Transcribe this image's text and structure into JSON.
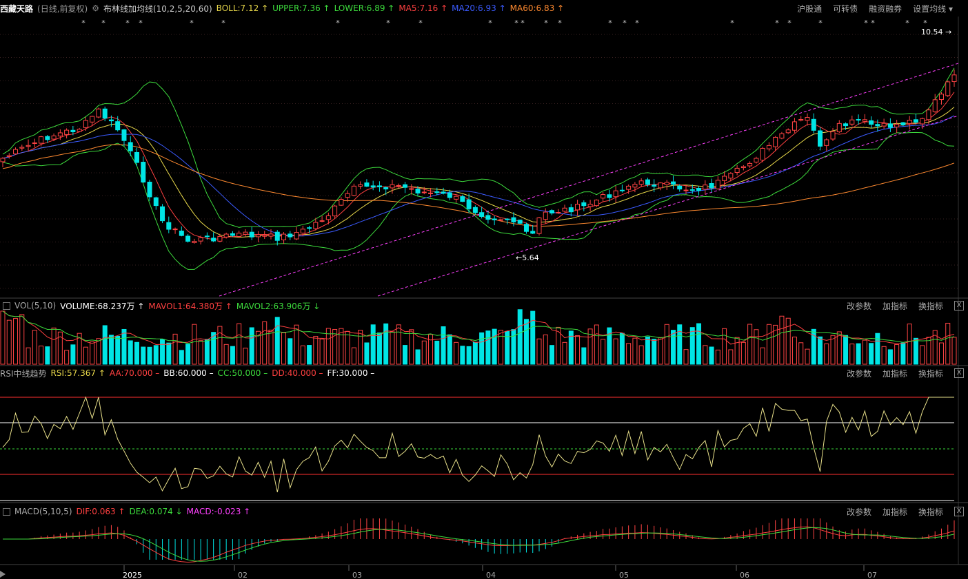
{
  "header": {
    "stock_name": "西藏天路",
    "mode": "(日线,前复权)",
    "indicator_name": "布林线加均线(10,2,5,20,60)",
    "values": [
      {
        "label": "BOLL:7.12 ↑",
        "color": "#e8d84a"
      },
      {
        "label": "UPPER:7.36 ↑",
        "color": "#3ddc3d"
      },
      {
        "label": "LOWER:6.89 ↑",
        "color": "#3ddc3d"
      },
      {
        "label": "MA5:7.16 ↑",
        "color": "#ff4040"
      },
      {
        "label": "MA20:6.93 ↑",
        "color": "#3b5bff"
      },
      {
        "label": "MA60:6.83 ↑",
        "color": "#ff8a30"
      }
    ],
    "links": [
      "沪股通",
      "可转债",
      "融资融券",
      "设置均线"
    ]
  },
  "price_panel": {
    "high_label": "10.54",
    "low_label": "5.64",
    "star_marks": [
      "*",
      "*",
      "*",
      "*",
      "*",
      "*",
      "*",
      "*",
      "*",
      "*",
      "*",
      "*",
      "*",
      "*",
      "*",
      "*",
      "*",
      "*",
      "*",
      "*",
      "*",
      "*",
      "*",
      "*",
      "*"
    ]
  },
  "vol_panel": {
    "title": "VOL(5,10)",
    "values": [
      {
        "label": "VOLUME:68.237万 ↑",
        "color": "#ffffff"
      },
      {
        "label": "MAVOL1:64.380万 ↑",
        "color": "#ff4040"
      },
      {
        "label": "MAVOL2:63.906万 ↓",
        "color": "#3ddc3d"
      }
    ]
  },
  "rsi_panel": {
    "title": "RSI中线趋势",
    "values": [
      {
        "label": "RSI:57.367 ↑",
        "color": "#e8d84a"
      },
      {
        "label": "AA:70.000 –",
        "color": "#ff4040"
      },
      {
        "label": "BB:60.000 –",
        "color": "#ffffff"
      },
      {
        "label": "CC:50.000 –",
        "color": "#3ddc3d"
      },
      {
        "label": "DD:40.000 –",
        "color": "#ff4040"
      },
      {
        "label": "FF:30.000 –",
        "color": "#ffffff"
      }
    ]
  },
  "macd_panel": {
    "title": "MACD(5,10,5)",
    "values": [
      {
        "label": "DIF:0.063 ↑",
        "color": "#ff4040"
      },
      {
        "label": "DEA:0.074 ↓",
        "color": "#3ddc3d"
      },
      {
        "label": "MACD:-0.023 ↑",
        "color": "#ff40ff"
      }
    ]
  },
  "panel_links": [
    "改参数",
    "加指标",
    "换指标"
  ],
  "close_glyph": "X",
  "x_axis": [
    "2025",
    "02",
    "03",
    "04",
    "05",
    "06",
    "07"
  ],
  "colors": {
    "up": "#ff4444",
    "down": "#00e5e5",
    "boll_mid": "#e8d84a",
    "boll_band": "#3ddc3d",
    "ma20": "#3b5bff",
    "ma60": "#ff8a30",
    "ma5": "#ff4040",
    "channel": "#ff40ff"
  }
}
